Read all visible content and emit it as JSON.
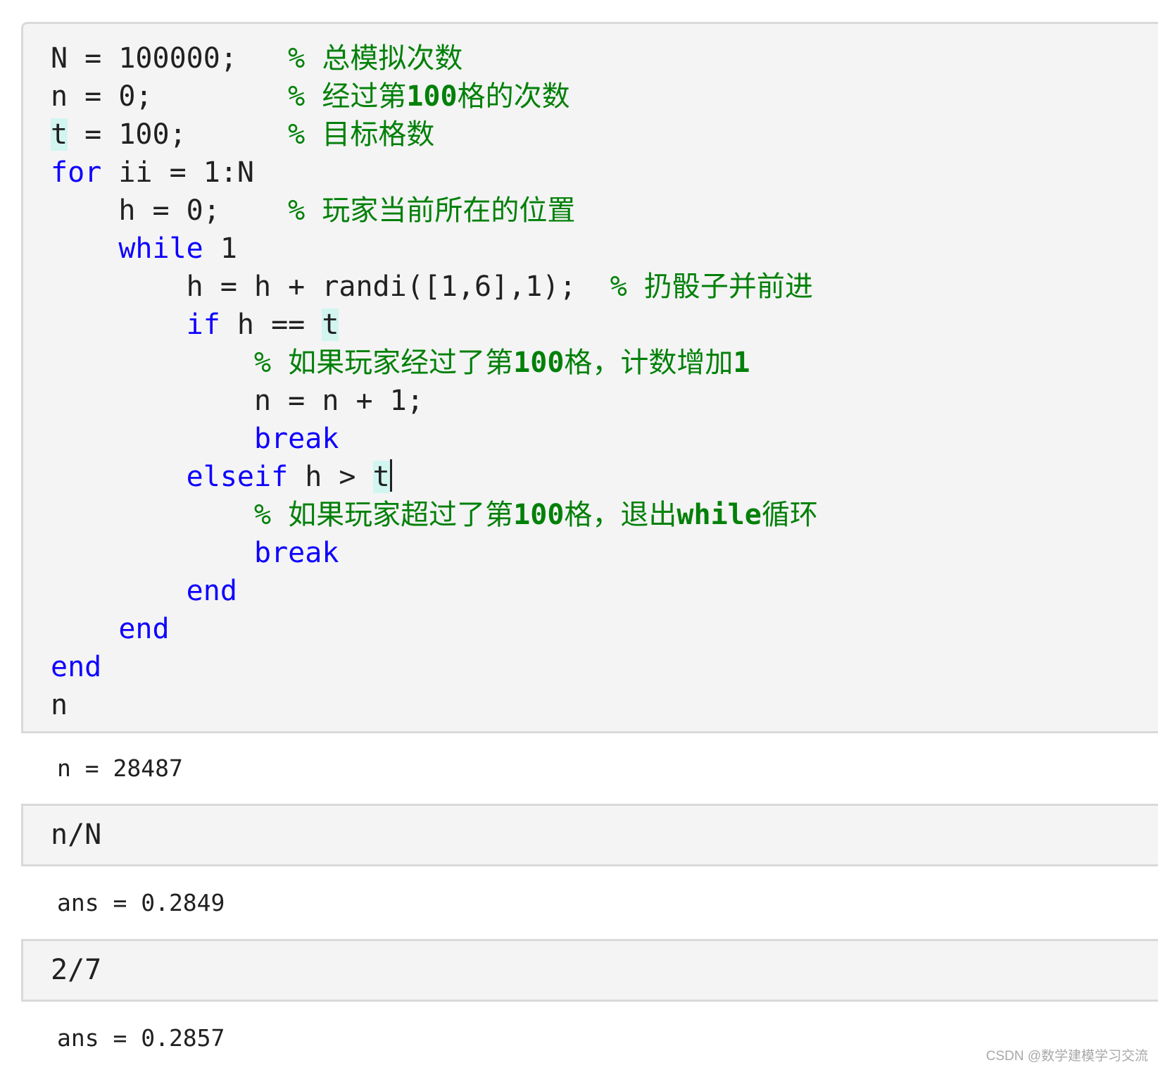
{
  "colors": {
    "keyword": "#0e00ff",
    "comment": "#028009",
    "text": "#212121",
    "cell_background": "#f4f4f4",
    "cell_border": "#d9d9d9",
    "highlight": "#d2f5f0",
    "watermark": "#a8a8a8"
  },
  "cells": [
    {
      "type": "code",
      "lines": [
        {
          "indent": "",
          "parts": [
            {
              "t": "code",
              "v": "N = 100000;   "
            },
            {
              "t": "comment",
              "v": "% 总模拟次数"
            }
          ]
        },
        {
          "indent": "",
          "parts": [
            {
              "t": "code",
              "v": "n = 0;        "
            },
            {
              "t": "comment",
              "v": "% 经过第100格的次数"
            }
          ]
        },
        {
          "indent": "",
          "parts": [
            {
              "t": "hl",
              "v": "t"
            },
            {
              "t": "code",
              "v": " = 100;      "
            },
            {
              "t": "comment",
              "v": "% 目标格数"
            }
          ]
        },
        {
          "indent": "",
          "parts": [
            {
              "t": "kw",
              "v": "for"
            },
            {
              "t": "code",
              "v": " ii = 1:N"
            }
          ]
        },
        {
          "indent": "    ",
          "parts": [
            {
              "t": "code",
              "v": "h = 0;    "
            },
            {
              "t": "comment",
              "v": "% 玩家当前所在的位置"
            }
          ]
        },
        {
          "indent": "    ",
          "parts": [
            {
              "t": "kw",
              "v": "while"
            },
            {
              "t": "code",
              "v": " 1"
            }
          ]
        },
        {
          "indent": "        ",
          "parts": [
            {
              "t": "code",
              "v": "h = h + randi([1,6],1);  "
            },
            {
              "t": "comment",
              "v": "% 扔骰子并前进"
            }
          ]
        },
        {
          "indent": "        ",
          "parts": [
            {
              "t": "kw",
              "v": "if"
            },
            {
              "t": "code",
              "v": " h == "
            },
            {
              "t": "hl",
              "v": "t"
            }
          ]
        },
        {
          "indent": "            ",
          "parts": [
            {
              "t": "comment",
              "v": "% 如果玩家经过了第100格，计数增加1"
            }
          ]
        },
        {
          "indent": "            ",
          "parts": [
            {
              "t": "code",
              "v": "n = n + 1;"
            }
          ]
        },
        {
          "indent": "            ",
          "parts": [
            {
              "t": "kw",
              "v": "break"
            }
          ]
        },
        {
          "indent": "        ",
          "parts": [
            {
              "t": "kw",
              "v": "elseif"
            },
            {
              "t": "code",
              "v": " h > "
            },
            {
              "t": "hl",
              "v": "t"
            },
            {
              "t": "caret",
              "v": ""
            }
          ]
        },
        {
          "indent": "            ",
          "parts": [
            {
              "t": "comment",
              "v": "% 如果玩家超过了第100格，退出while循环"
            }
          ]
        },
        {
          "indent": "            ",
          "parts": [
            {
              "t": "kw",
              "v": "break"
            }
          ]
        },
        {
          "indent": "        ",
          "parts": [
            {
              "t": "kw",
              "v": "end"
            }
          ]
        },
        {
          "indent": "    ",
          "parts": [
            {
              "t": "kw",
              "v": "end"
            }
          ]
        },
        {
          "indent": "",
          "parts": [
            {
              "t": "kw",
              "v": "end"
            }
          ]
        },
        {
          "indent": "",
          "parts": [
            {
              "t": "code",
              "v": "n"
            }
          ]
        }
      ],
      "output": "n = 28487"
    },
    {
      "type": "code",
      "lines": [
        {
          "indent": "",
          "parts": [
            {
              "t": "code",
              "v": "n/N"
            }
          ]
        }
      ],
      "output": "ans = 0.2849"
    },
    {
      "type": "code",
      "lines": [
        {
          "indent": "",
          "parts": [
            {
              "t": "code",
              "v": "2/7"
            }
          ]
        }
      ],
      "output": "ans = 0.2857"
    }
  ],
  "watermark": "CSDN @数学建模学习交流"
}
